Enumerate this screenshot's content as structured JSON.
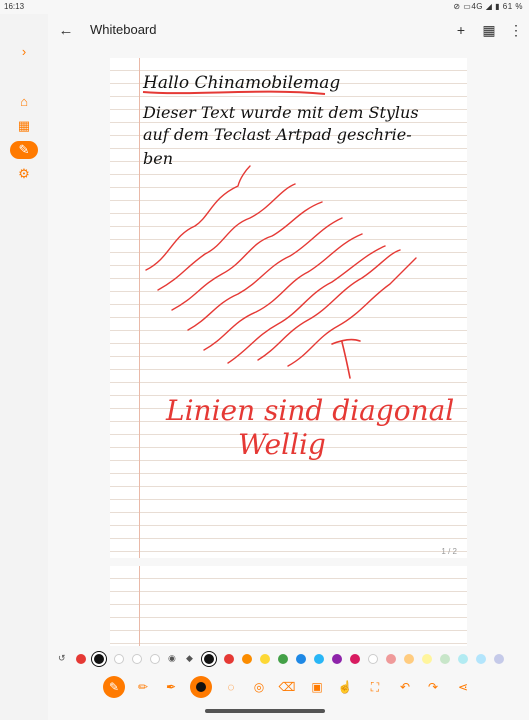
{
  "status": {
    "time": "16:13",
    "indicators": "⊘ ▭4G ◢ ▮ 61 %"
  },
  "header": {
    "title": "Whiteboard"
  },
  "sidebar": {
    "expand_icon": "chevron-right-icon",
    "items": [
      {
        "name": "home-icon",
        "active": false
      },
      {
        "name": "dashboard-icon",
        "active": false
      },
      {
        "name": "edit-note-icon",
        "active": true
      },
      {
        "name": "settings-image-icon",
        "active": false
      }
    ]
  },
  "topbar_icons": [
    "add-icon",
    "grid-icon",
    "more-vert-icon"
  ],
  "page": {
    "page_number": "1 / 2",
    "handwriting": {
      "line1": "Hallo Chinamobilemag",
      "line2": "Dieser Text wurde mit dem Stylus",
      "line3": "auf dem Teclast Artpad geschrie-",
      "line4": "ben",
      "line5": "Linien sind diagonal",
      "line6": "Wellig"
    }
  },
  "palette": {
    "colors": [
      "#e53935",
      "#111111",
      "#ffffff",
      "#ffffff",
      "#ffffff",
      "#111111",
      "#e53935",
      "#fb8c00",
      "#fdd835",
      "#43a047",
      "#1e88e5",
      "#1e88e5",
      "#8e24aa",
      "#d81b60",
      "#ffffff",
      "#ef9a9a",
      "#ffcc80",
      "#fff59d",
      "#c8e6c9",
      "#b2ebf2",
      "#b3e5fc",
      "#c5cae9"
    ],
    "selected_index": 1
  },
  "toolbar": {
    "tools": [
      "pen-icon",
      "pencil-icon",
      "marker-icon",
      "brush-color-icon",
      "lasso-icon",
      "shape-icon",
      "eraser-icon",
      "image-icon",
      "touch-icon",
      "fit-screen-icon",
      "undo-icon",
      "redo-icon",
      "share-icon"
    ],
    "accent": "#ff7a00"
  }
}
